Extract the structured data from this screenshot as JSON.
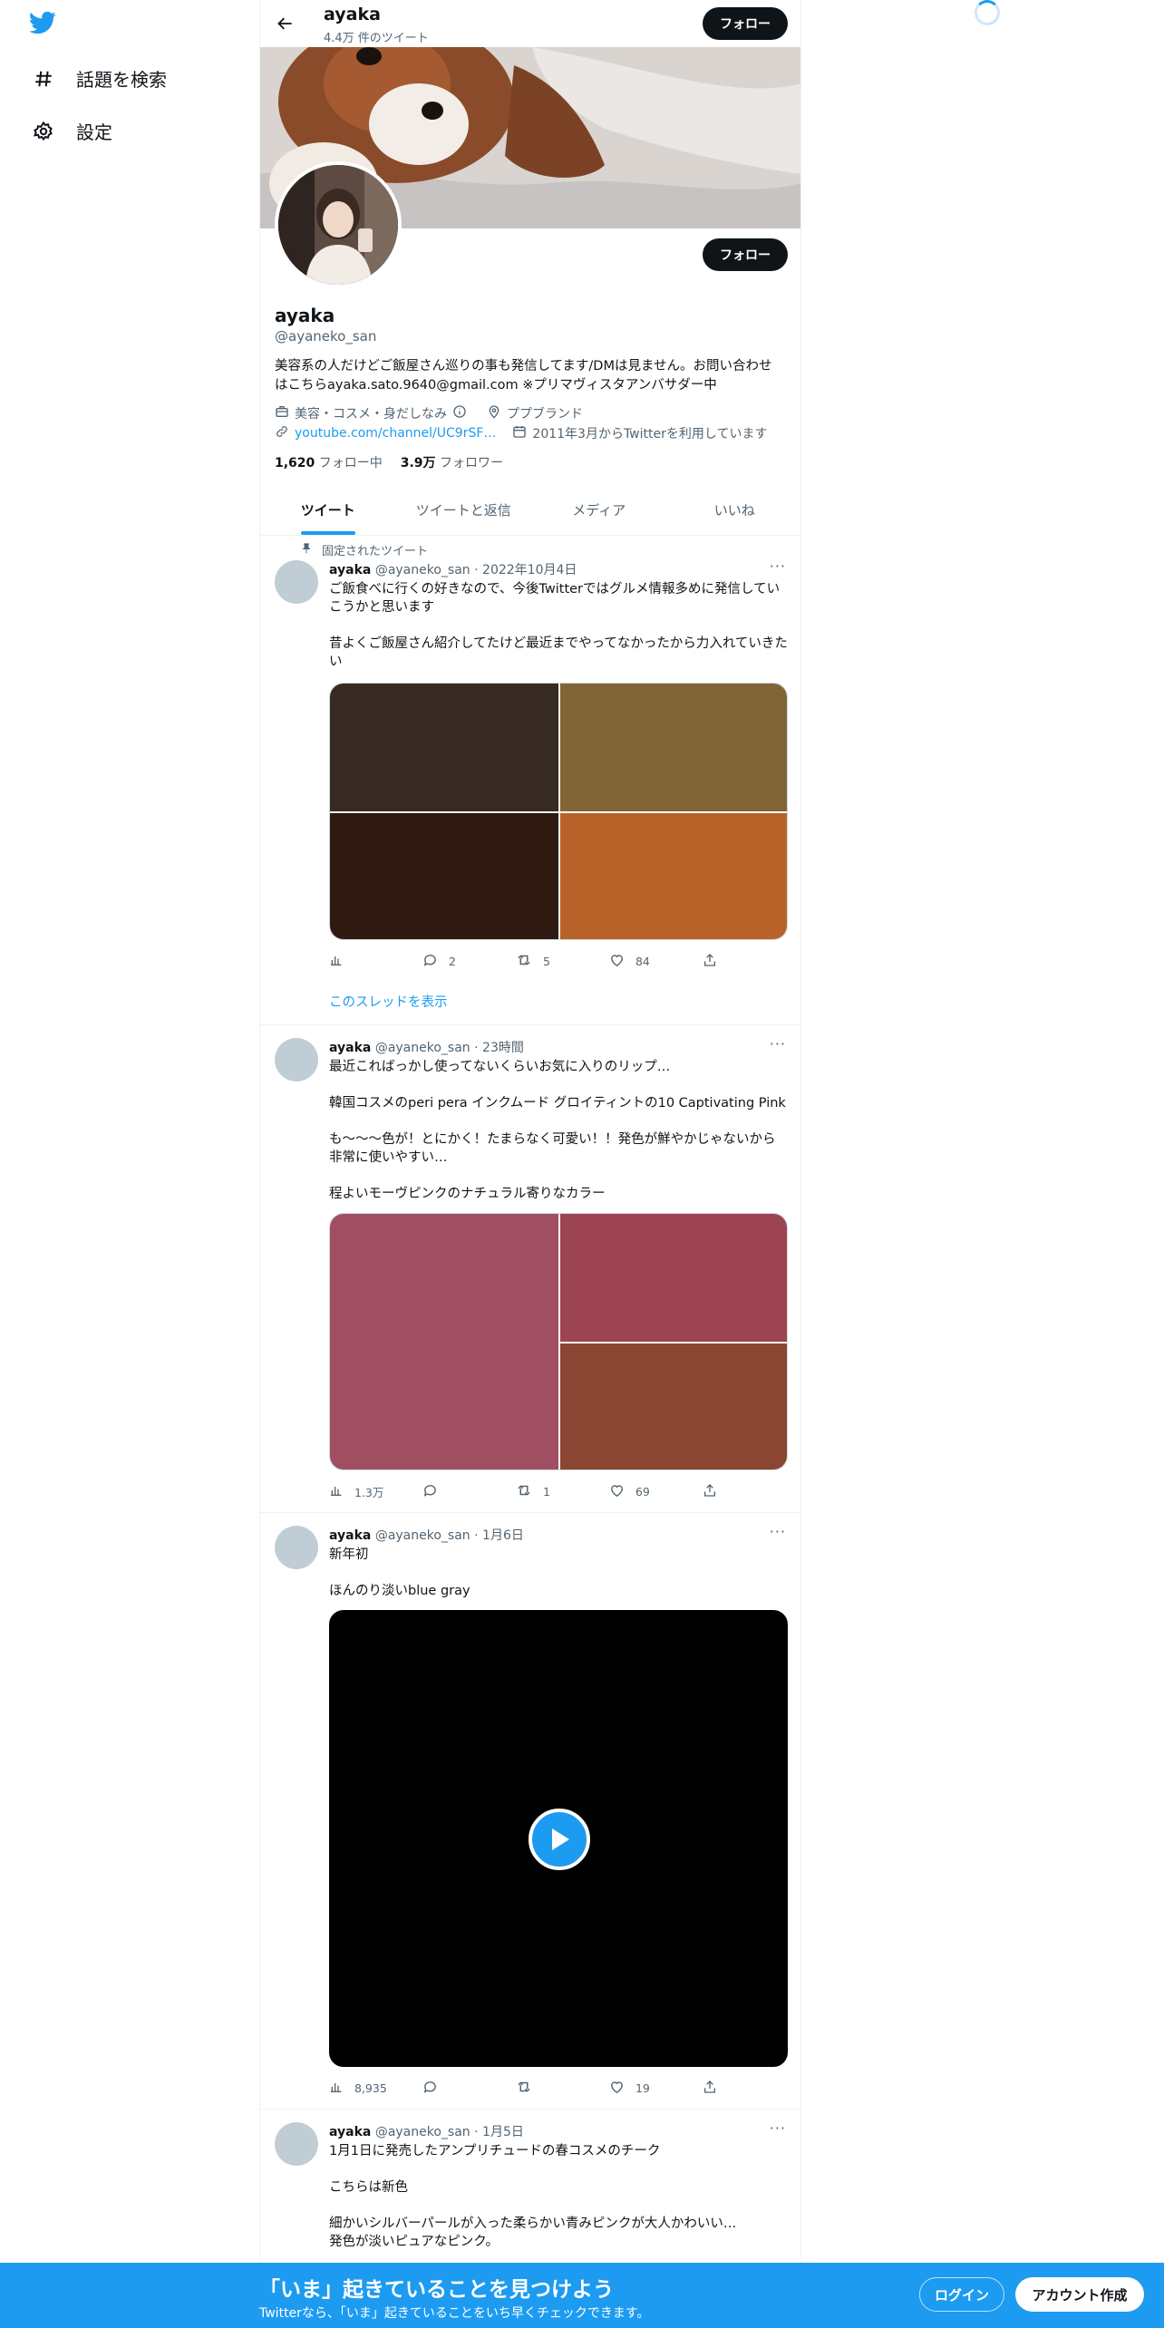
{
  "sidebar": {
    "items": [
      {
        "label": "話題を検索",
        "icon": "hashtag-icon"
      },
      {
        "label": "設定",
        "icon": "gear-icon"
      }
    ]
  },
  "header": {
    "name": "ayaka",
    "tweet_count": "4.4万 件のツイート",
    "follow_label": "フォロー"
  },
  "profile": {
    "name": "ayaka",
    "handle": "@ayaneko_san",
    "follow_label": "フォロー",
    "bio": "美容系の人だけどご飯屋さん巡りの事も発信してます/DMは見ません。お問い合わせはこちらayaka.sato.9640@gmail.com ※プリマヴィスタアンバサダー中",
    "category": "美容・コスメ・身だしなみ",
    "location": "ププブランド",
    "link": "youtube.com/channel/UC9rSF…",
    "joined": "2011年3月からTwitterを利用しています",
    "following_count": "1,620",
    "following_label": "フォロー中",
    "followers_count": "3.9万",
    "followers_label": "フォロワー"
  },
  "tabs": [
    "ツイート",
    "ツイートと返信",
    "メディア",
    "いいね"
  ],
  "pinned_label": "固定されたツイート",
  "tweets": [
    {
      "name": "ayaka",
      "handle": "@ayaneko_san",
      "time": "2022年10月4日",
      "text": "ご飯食べに行くの好きなので、今後Twitterではグルメ情報多めに発信していこうかと思います\n\n昔よくご飯屋さん紹介してたけど最近までやってなかったから力入れていきたい",
      "views": "",
      "replies": "2",
      "retweets": "5",
      "likes": "84",
      "thread_label": "このスレッドを表示"
    },
    {
      "name": "ayaka",
      "handle": "@ayaneko_san",
      "time": "23時間",
      "text": "最近こればっかし使ってないくらいお気に入りのリップ…\n\n韓国コスメのperi pera インクムード グロイティントの10 Captivating Pink\n\nも〜〜〜色が！とにかく！たまらなく可愛い！！発色が鮮やかじゃないから非常に使いやすい…\n\n程よいモーヴピンクのナチュラル寄りなカラー",
      "views": "1.3万",
      "replies": "",
      "retweets": "1",
      "likes": "69"
    },
    {
      "name": "ayaka",
      "handle": "@ayaneko_san",
      "time": "1月6日",
      "text": "新年初\n\nほんのり淡いblue gray",
      "views": "8,935",
      "replies": "",
      "retweets": "",
      "likes": "19"
    },
    {
      "name": "ayaka",
      "handle": "@ayaneko_san",
      "time": "1月5日",
      "text": "1月1日に発売したアンプリチュードの春コスメのチーク\n\nこちらは新色\n\n細かいシルバーパールが入った柔らかい青みピンクが大人かわいい…\n発色が淡いピュアなピンク。"
    }
  ],
  "bottom_bar": {
    "title": "「いま」起きていることを見つけよう",
    "subtitle": "Twitterなら、「いま」起きていることをいち早くチェックできます。",
    "login_label": "ログイン",
    "signup_label": "アカウント作成"
  },
  "colors": {
    "accent": "#1d9bf0",
    "text": "#0f1419",
    "muted": "#536471"
  }
}
